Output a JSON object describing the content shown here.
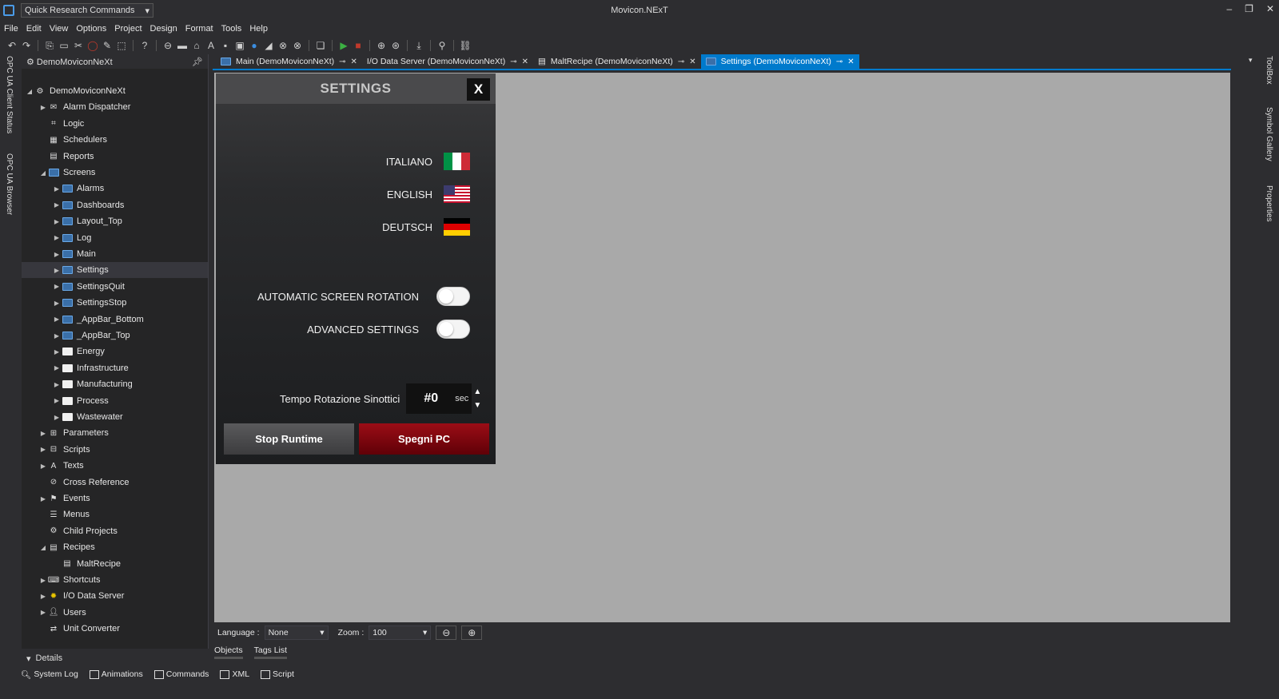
{
  "titlebar": {
    "quick_search": "Quick Research Commands",
    "window_title": "Movicon.NExT"
  },
  "menu": [
    "File",
    "Edit",
    "View",
    "Options",
    "Project",
    "Design",
    "Format",
    "Tools",
    "Help"
  ],
  "left_rail": [
    "OPC UA Client Status",
    "OPC UA Browser"
  ],
  "right_rail": [
    "ToolBox",
    "Symbol Gallery",
    "Properties"
  ],
  "explorer": {
    "header": "DemoMoviconNeXt",
    "tree": [
      {
        "label": "DemoMoviconNeXt",
        "level": 0,
        "expanded": true,
        "icon": "gear-icon"
      },
      {
        "label": "Alarm Dispatcher",
        "level": 1,
        "expanded": false,
        "icon": "dispatcher-icon"
      },
      {
        "label": "Logic",
        "level": 1,
        "expanded": null,
        "icon": "logic-icon"
      },
      {
        "label": "Schedulers",
        "level": 1,
        "expanded": null,
        "icon": "calendar-icon"
      },
      {
        "label": "Reports",
        "level": 1,
        "expanded": null,
        "icon": "report-icon"
      },
      {
        "label": "Screens",
        "level": 1,
        "expanded": true,
        "icon": "screen-icon"
      },
      {
        "label": "Alarms",
        "level": 2,
        "expanded": false,
        "icon": "screen-icon"
      },
      {
        "label": "Dashboards",
        "level": 2,
        "expanded": false,
        "icon": "screen-icon"
      },
      {
        "label": "Layout_Top",
        "level": 2,
        "expanded": false,
        "icon": "screen-icon"
      },
      {
        "label": "Log",
        "level": 2,
        "expanded": false,
        "icon": "screen-icon"
      },
      {
        "label": "Main",
        "level": 2,
        "expanded": false,
        "icon": "screen-icon"
      },
      {
        "label": "Settings",
        "level": 2,
        "expanded": false,
        "icon": "screen-icon",
        "selected": true
      },
      {
        "label": "SettingsQuit",
        "level": 2,
        "expanded": false,
        "icon": "screen-icon"
      },
      {
        "label": "SettingsStop",
        "level": 2,
        "expanded": false,
        "icon": "screen-icon"
      },
      {
        "label": "_AppBar_Bottom",
        "level": 2,
        "expanded": false,
        "icon": "screen-icon"
      },
      {
        "label": "_AppBar_Top",
        "level": 2,
        "expanded": false,
        "icon": "screen-icon"
      },
      {
        "label": "Energy",
        "level": 2,
        "expanded": false,
        "icon": "folder-icon"
      },
      {
        "label": "Infrastructure",
        "level": 2,
        "expanded": false,
        "icon": "folder-icon"
      },
      {
        "label": "Manufacturing",
        "level": 2,
        "expanded": false,
        "icon": "folder-icon"
      },
      {
        "label": "Process",
        "level": 2,
        "expanded": false,
        "icon": "folder-icon"
      },
      {
        "label": "Wastewater",
        "level": 2,
        "expanded": false,
        "icon": "folder-icon"
      },
      {
        "label": "Parameters",
        "level": 1,
        "expanded": false,
        "icon": "parameters-icon"
      },
      {
        "label": "Scripts",
        "level": 1,
        "expanded": false,
        "icon": "script-icon"
      },
      {
        "label": "Texts",
        "level": 1,
        "expanded": false,
        "icon": "texts-icon"
      },
      {
        "label": "Cross Reference",
        "level": 1,
        "expanded": null,
        "icon": "crossref-icon"
      },
      {
        "label": "Events",
        "level": 1,
        "expanded": false,
        "icon": "events-icon"
      },
      {
        "label": "Menus",
        "level": 1,
        "expanded": null,
        "icon": "menu-icon"
      },
      {
        "label": "Child Projects",
        "level": 1,
        "expanded": null,
        "icon": "child-projects-icon"
      },
      {
        "label": "Recipes",
        "level": 1,
        "expanded": true,
        "icon": "recipe-icon"
      },
      {
        "label": "MaltRecipe",
        "level": 2,
        "expanded": null,
        "icon": "recipe-icon"
      },
      {
        "label": "Shortcuts",
        "level": 1,
        "expanded": false,
        "icon": "shortcut-icon"
      },
      {
        "label": "I/O Data Server",
        "level": 1,
        "expanded": false,
        "icon": "io-server-icon"
      },
      {
        "label": "Users",
        "level": 1,
        "expanded": false,
        "icon": "user-icon"
      },
      {
        "label": "Unit Converter",
        "level": 1,
        "expanded": null,
        "icon": "unit-converter-icon"
      }
    ],
    "details_label": "Details"
  },
  "doc_tabs": [
    {
      "label": "Main (DemoMoviconNeXt)",
      "active": false
    },
    {
      "label": "I/O Data Server (DemoMoviconNeXt)",
      "active": false
    },
    {
      "label": "MaltRecipe (DemoMoviconNeXt)",
      "active": false
    },
    {
      "label": "Settings (DemoMoviconNeXt)",
      "active": true
    }
  ],
  "settings_panel": {
    "title": "SETTINGS",
    "close_label": "X",
    "languages": [
      "ITALIANO",
      "ENGLISH",
      "DEUTSCH"
    ],
    "toggles": [
      {
        "label": "AUTOMATIC SCREEN ROTATION",
        "on": false
      },
      {
        "label": "ADVANCED SETTINGS",
        "on": false
      }
    ],
    "tempo_label": "Tempo Rotazione Sinottici",
    "tempo_value": "#0",
    "tempo_unit": "sec",
    "stop_runtime": "Stop Runtime",
    "shutdown_pc": "Spegni PC"
  },
  "statusbar": {
    "language_label": "Language :",
    "language_value": "None",
    "zoom_label": "Zoom :",
    "zoom_value": "100"
  },
  "bottom_tabs": [
    "Objects",
    "Tags List"
  ],
  "footer": [
    "System Log",
    "Animations",
    "Commands",
    "XML",
    "Script"
  ],
  "colors": {
    "accent": "#007acc",
    "stop_btn": "#4a4a4c",
    "shutdown_btn": "#8b0a12"
  }
}
